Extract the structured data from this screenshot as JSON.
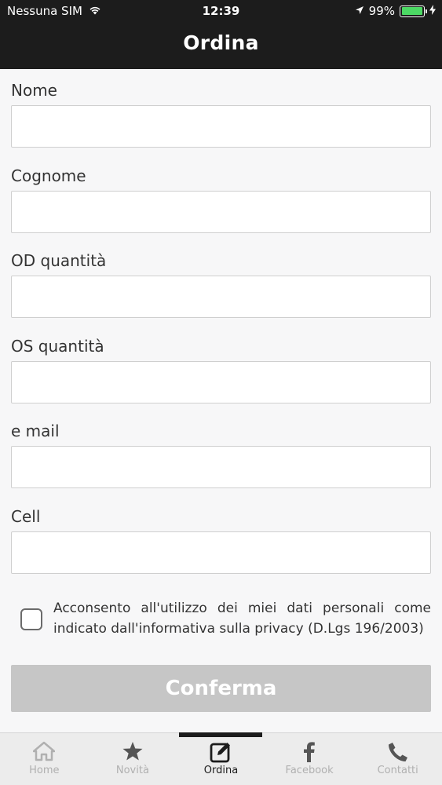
{
  "status_bar": {
    "carrier": "Nessuna SIM",
    "time": "12:39",
    "battery": "99%",
    "battery_level": 0.99
  },
  "nav": {
    "title": "Ordina"
  },
  "form": {
    "fields": [
      {
        "label": "Nome",
        "value": ""
      },
      {
        "label": "Cognome",
        "value": ""
      },
      {
        "label": "OD quantità",
        "value": ""
      },
      {
        "label": "OS quantità",
        "value": ""
      },
      {
        "label": "e mail",
        "value": ""
      },
      {
        "label": "Cell",
        "value": ""
      }
    ],
    "consent": {
      "text": "Acconsento all'utilizzo dei miei dati personali come indicato dall'informativa sulla privacy (D.Lgs 196/2003)",
      "checked": false
    },
    "submit_label": "Conferma"
  },
  "tabs": [
    {
      "label": "Home",
      "icon": "home-icon",
      "active": false
    },
    {
      "label": "Novità",
      "icon": "star-icon",
      "active": false
    },
    {
      "label": "Ordina",
      "icon": "edit-icon",
      "active": true
    },
    {
      "label": "Facebook",
      "icon": "facebook-icon",
      "active": false
    },
    {
      "label": "Contatti",
      "icon": "phone-icon",
      "active": false
    }
  ],
  "colors": {
    "header_bg": "#1c1c1c",
    "button_disabled_bg": "#c6c6c6",
    "battery_green": "#4cd964",
    "tab_inactive": "#b0b0b0"
  }
}
